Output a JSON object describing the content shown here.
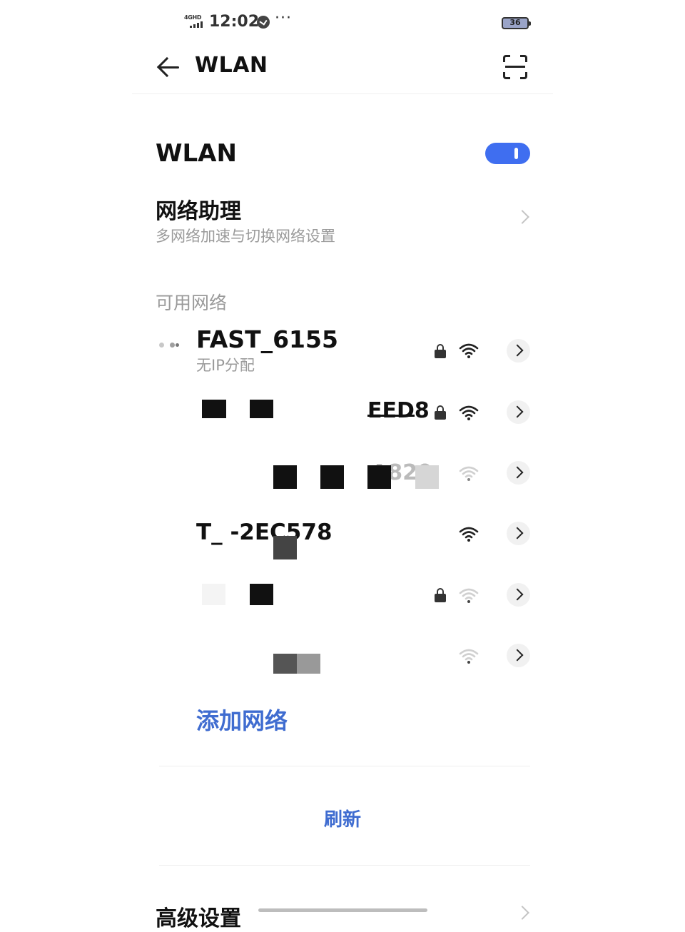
{
  "status_bar": {
    "network_tag": "4GHD",
    "time": "12:02",
    "more": "···",
    "battery": "36"
  },
  "header": {
    "title": "WLAN"
  },
  "wlan": {
    "label": "WLAN",
    "enabled": true,
    "accent_color": "#3f6ef0"
  },
  "assistant": {
    "title": "网络助理",
    "subtitle": "多网络加速与切换网络设置"
  },
  "available_section": {
    "label": "可用网络"
  },
  "networks": [
    {
      "name": "FAST_6155",
      "status": "无IP分配",
      "secured": true,
      "signal_level": 3
    },
    {
      "name": "EED8",
      "secured": true,
      "signal_level": 3,
      "obscured": true
    },
    {
      "name": "A820",
      "secured": false,
      "signal_level": 1,
      "obscured": true
    },
    {
      "name": "T_ -2EC578",
      "secured": false,
      "signal_level": 3,
      "obscured": true
    },
    {
      "name": "",
      "secured": true,
      "signal_level": 1,
      "obscured": true
    },
    {
      "name": "",
      "secured": false,
      "signal_level": 1,
      "obscured": true
    }
  ],
  "actions": {
    "add_network": "添加网络",
    "refresh": "刷新",
    "advanced": "高级设置"
  },
  "colors": {
    "link_blue": "#3f6cd0"
  }
}
